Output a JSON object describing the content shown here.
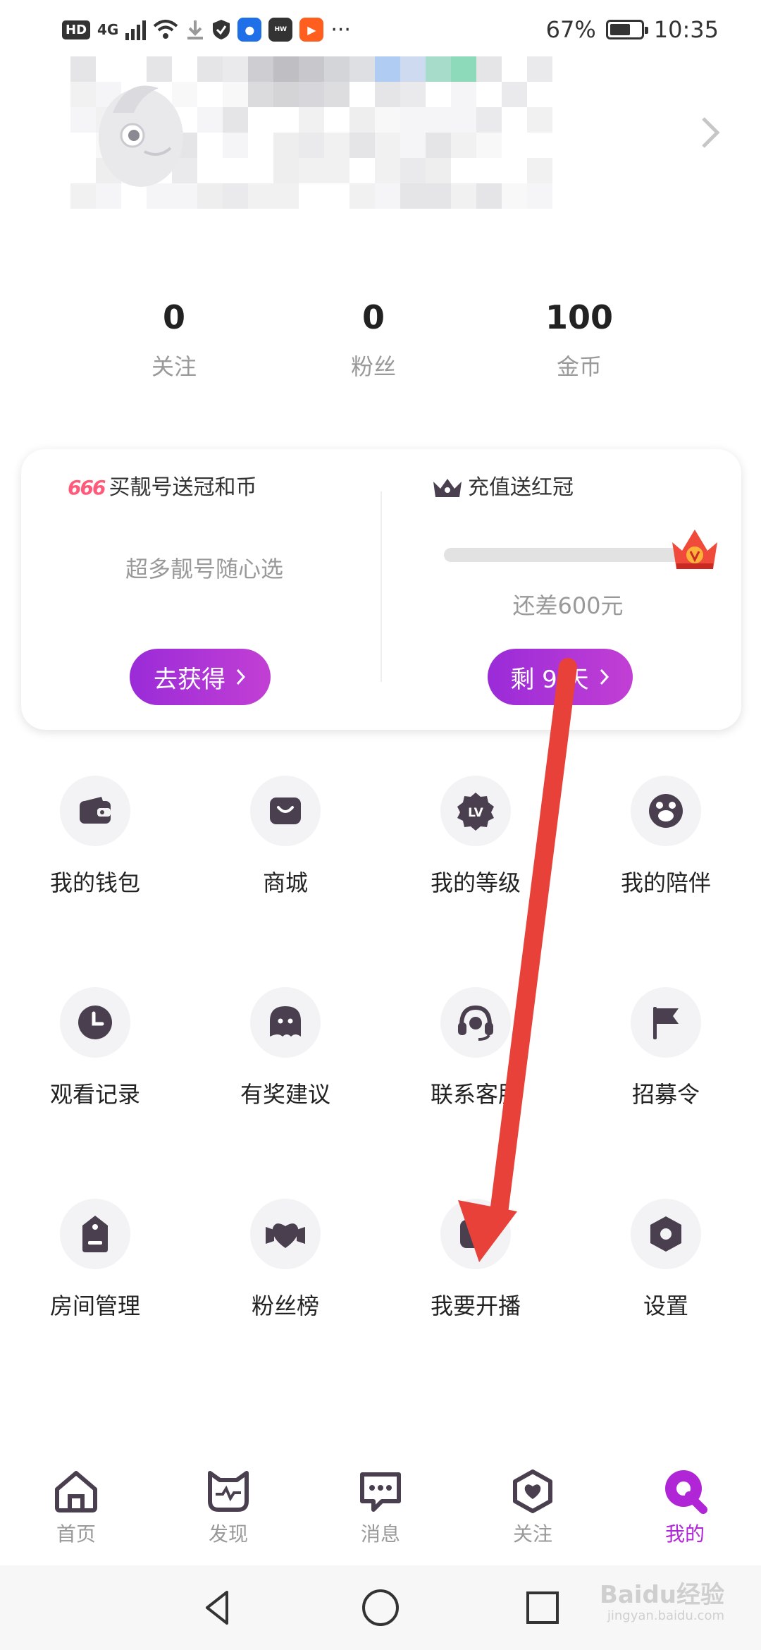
{
  "status_bar": {
    "hd": "HD",
    "network": "4G",
    "more": "···",
    "battery_percent": "67%",
    "battery_level": 0.67,
    "time": "10:35",
    "app_icons": [
      "download-icon",
      "shield-icon",
      "bulb-app-icon",
      "huawei-app-icon",
      "kuaishou-app-icon"
    ]
  },
  "stats": [
    {
      "value": "0",
      "label": "关注"
    },
    {
      "value": "0",
      "label": "粉丝"
    },
    {
      "value": "100",
      "label": "金币"
    }
  ],
  "promo": {
    "left": {
      "badge": "666",
      "title": "买靓号送冠和币",
      "subtitle": "超多靓号随心选",
      "button": "去获得"
    },
    "right": {
      "title": "充值送红冠",
      "subtitle": "还差600元",
      "button": "剩 9 天",
      "progress": 0.0
    }
  },
  "menu": [
    {
      "label": "我的钱包",
      "icon": "wallet-icon"
    },
    {
      "label": "商城",
      "icon": "shop-bag-icon"
    },
    {
      "label": "我的等级",
      "icon": "level-badge-icon",
      "icon_text": "LV"
    },
    {
      "label": "我的陪伴",
      "icon": "companion-paw-icon"
    },
    {
      "label": "观看记录",
      "icon": "clock-icon"
    },
    {
      "label": "有奖建议",
      "icon": "feedback-bubble-icon"
    },
    {
      "label": "联系客服",
      "icon": "headset-icon"
    },
    {
      "label": "招募令",
      "icon": "flag-icon"
    },
    {
      "label": "房间管理",
      "icon": "room-tag-icon"
    },
    {
      "label": "粉丝榜",
      "icon": "heart-ribbon-icon"
    },
    {
      "label": "我要开播",
      "icon": "live-broadcast-icon"
    },
    {
      "label": "设置",
      "icon": "hexagon-settings-icon"
    }
  ],
  "bottom_nav": [
    {
      "label": "首页",
      "icon": "home-icon",
      "active": false
    },
    {
      "label": "发现",
      "icon": "discover-cat-icon",
      "active": false
    },
    {
      "label": "消息",
      "icon": "message-icon",
      "active": false
    },
    {
      "label": "关注",
      "icon": "follow-heart-shield-icon",
      "active": false
    },
    {
      "label": "我的",
      "icon": "profile-q-icon",
      "active": true
    }
  ],
  "watermark": {
    "brand": "Baidu经验",
    "url": "jingyan.baidu.com"
  },
  "colors": {
    "accent": "#b026d6",
    "pill_start": "#9a2bd8",
    "pill_end": "#c23fd4",
    "icon_fg": "#4a3f4f",
    "icon_bg": "#f3f3f5",
    "annotation_arrow": "#e8413a"
  }
}
